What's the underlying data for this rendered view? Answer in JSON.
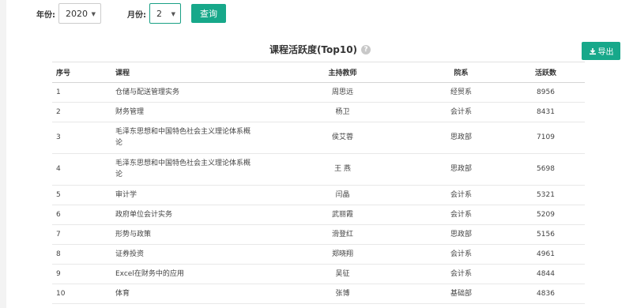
{
  "filters": {
    "year_label": "年份:",
    "year_value": "2020",
    "month_label": "月份:",
    "month_value": "2",
    "query_button": "查询"
  },
  "card": {
    "title": "课程活跃度(Top10)",
    "help_icon": "?",
    "export_icon": "download-icon",
    "export_label": "导出"
  },
  "table": {
    "headers": {
      "index": "序号",
      "course": "课程",
      "teacher": "主持教师",
      "department": "院系",
      "activity": "活跃数"
    },
    "rows": [
      {
        "index": "1",
        "course_line1": "仓储与配送管理实务",
        "course_line2": "",
        "teacher": "周思远",
        "department": "经贸系",
        "activity": "8956"
      },
      {
        "index": "2",
        "course_line1": "财务管理",
        "course_line2": "",
        "teacher": "杨卫",
        "department": "会计系",
        "activity": "8431"
      },
      {
        "index": "3",
        "course_line1": "毛泽东思想和中国特色社会主义理论体系概",
        "course_line2": "论",
        "teacher": "侯艾蓉",
        "department": "思政部",
        "activity": "7109"
      },
      {
        "index": "4",
        "course_line1": "毛泽东思想和中国特色社会主义理论体系概",
        "course_line2": "论",
        "teacher": "王 燕",
        "department": "思政部",
        "activity": "5698"
      },
      {
        "index": "5",
        "course_line1": "审计学",
        "course_line2": "",
        "teacher": "闫晶",
        "department": "会计系",
        "activity": "5321"
      },
      {
        "index": "6",
        "course_line1": "政府单位会计实务",
        "course_line2": "",
        "teacher": "武丽霞",
        "department": "会计系",
        "activity": "5209"
      },
      {
        "index": "7",
        "course_line1": "形势与政策",
        "course_line2": "",
        "teacher": "滑登红",
        "department": "思政部",
        "activity": "5156"
      },
      {
        "index": "8",
        "course_line1": "证券投资",
        "course_line2": "",
        "teacher": "郑晓翔",
        "department": "会计系",
        "activity": "4961"
      },
      {
        "index": "9",
        "course_line1": "Excel在财务中的应用",
        "course_line2": "",
        "teacher": "吴征",
        "department": "会计系",
        "activity": "4844"
      },
      {
        "index": "10",
        "course_line1": "体育",
        "course_line2": "",
        "teacher": "张博",
        "department": "基础部",
        "activity": "4836"
      }
    ]
  }
}
